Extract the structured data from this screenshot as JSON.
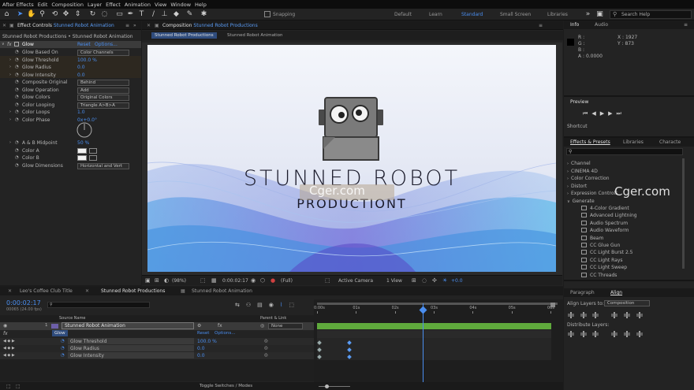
{
  "menu": [
    "After Effects",
    "Edit",
    "Composition",
    "Layer",
    "Effect",
    "Animation",
    "View",
    "Window",
    "Help"
  ],
  "toolbar": {
    "snapping_label": "Snapping",
    "workspaces": [
      "Default",
      "Learn",
      "Standard",
      "Small Screen",
      "Libraries"
    ],
    "active_workspace": "Standard",
    "search_placeholder": "Search Help"
  },
  "effect_controls": {
    "tab_prefix": "Effect Controls",
    "tab_layer": "Stunned Robot Animation",
    "breadcrumb": "Stunned Robot Productions • Stunned Robot Animation",
    "effect_name": "Glow",
    "reset": "Reset",
    "options": "Options...",
    "props": [
      {
        "name": "Glow Based On",
        "value": "Color Channels",
        "kind": "dropdown"
      },
      {
        "name": "Glow Threshold",
        "value": "100.0 %",
        "kind": "value"
      },
      {
        "name": "Glow Radius",
        "value": "0.0",
        "kind": "value"
      },
      {
        "name": "Glow Intensity",
        "value": "0.0",
        "kind": "value"
      },
      {
        "name": "Composite Original",
        "value": "Behind",
        "kind": "dropdown"
      },
      {
        "name": "Glow Operation",
        "value": "Add",
        "kind": "dropdown"
      },
      {
        "name": "Glow Colors",
        "value": "Original Colors",
        "kind": "dropdown"
      },
      {
        "name": "Color Looping",
        "value": "Triangle A>B>A",
        "kind": "dropdown"
      },
      {
        "name": "Color Loops",
        "value": "1.0",
        "kind": "value"
      },
      {
        "name": "Color Phase",
        "value": "0x+0.0°",
        "kind": "value"
      }
    ],
    "props2": [
      {
        "name": "A & B Midpoint",
        "value": "50 %",
        "kind": "value"
      },
      {
        "name": "Color A",
        "value": "",
        "kind": "swatch"
      },
      {
        "name": "Color B",
        "value": "",
        "kind": "swatch"
      },
      {
        "name": "Glow Dimensions",
        "value": "Horizontal and Vert",
        "kind": "dropdown"
      }
    ]
  },
  "composition": {
    "tab_prefix": "Composition",
    "tab_name": "Stunned Robot Productions",
    "sub_tabs": [
      "Stunned Robot Productions",
      "Stunned Robot Animation"
    ],
    "title_line1": "STUNNED ROBOT",
    "title_line2": "PRODUCTIONT",
    "watermark": "Cger.com",
    "viewer_bar": {
      "zoom": "(98%)",
      "timecode": "0:00:02:17",
      "resolution": "(Full)",
      "camera": "Active Camera",
      "views": "1 View",
      "exposure": "+0.0"
    }
  },
  "info": {
    "tab": "Info",
    "tab2": "Audio",
    "r": "R :",
    "g": "G :",
    "b": "B :",
    "a": "A : 0.0000",
    "x": "X : 1927",
    "y": "Y : 873"
  },
  "preview": {
    "tab": "Preview"
  },
  "shortcut": {
    "label": "Shortcut"
  },
  "effects_presets": {
    "tab": "Effects & Presets",
    "tab2": "Libraries",
    "tab3": "Characte",
    "search_placeholder": "",
    "categories": [
      "Channel",
      "CINEMA 4D",
      "Color Correction",
      "Distort",
      "Expression Controls",
      "Generate"
    ],
    "items": [
      "4-Color Gradient",
      "Advanced Lightning",
      "Audio Spectrum",
      "Audio Waveform",
      "Beam",
      "CC Glue Gun",
      "CC Light Burst 2.5",
      "CC Light Rays",
      "CC Light Sweep",
      "CC Threads"
    ],
    "watermark": "Cger.com"
  },
  "align": {
    "tab1": "Paragraph",
    "tab2": "Align",
    "align_to_label": "Align Layers to:",
    "align_to_value": "Composition",
    "distribute_label": "Distribute Layers:"
  },
  "timeline": {
    "tabs": [
      "Leo's Coffee Club Title",
      "Stunned Robot Productions",
      "Stunned Robot Animation"
    ],
    "active_tab": "Stunned Robot Productions",
    "timecode": "0:00:02:17",
    "frames": "00065 (24.00 fps)",
    "col_source": "Source Name",
    "col_parent": "Parent & Link",
    "layer_num": "1",
    "layer_name": "Stunned Robot Animation",
    "parent_value": "None",
    "effect_label": "Glow",
    "reset": "Reset",
    "options": "Options...",
    "props": [
      {
        "name": "Glow Threshold",
        "value": "100.0 %"
      },
      {
        "name": "Glow Radius",
        "value": "0.0"
      },
      {
        "name": "Glow Intensity",
        "value": "0.0"
      }
    ],
    "ruler": [
      "0:00s",
      "01s",
      "02s",
      "03s",
      "04s",
      "05s",
      "06s"
    ],
    "toggle_label": "Toggle Switches / Modes",
    "fx_label": "fx"
  },
  "colors": {
    "accent": "#4a8ef0",
    "panel": "#232323",
    "bar_green": "#5faa3c"
  }
}
